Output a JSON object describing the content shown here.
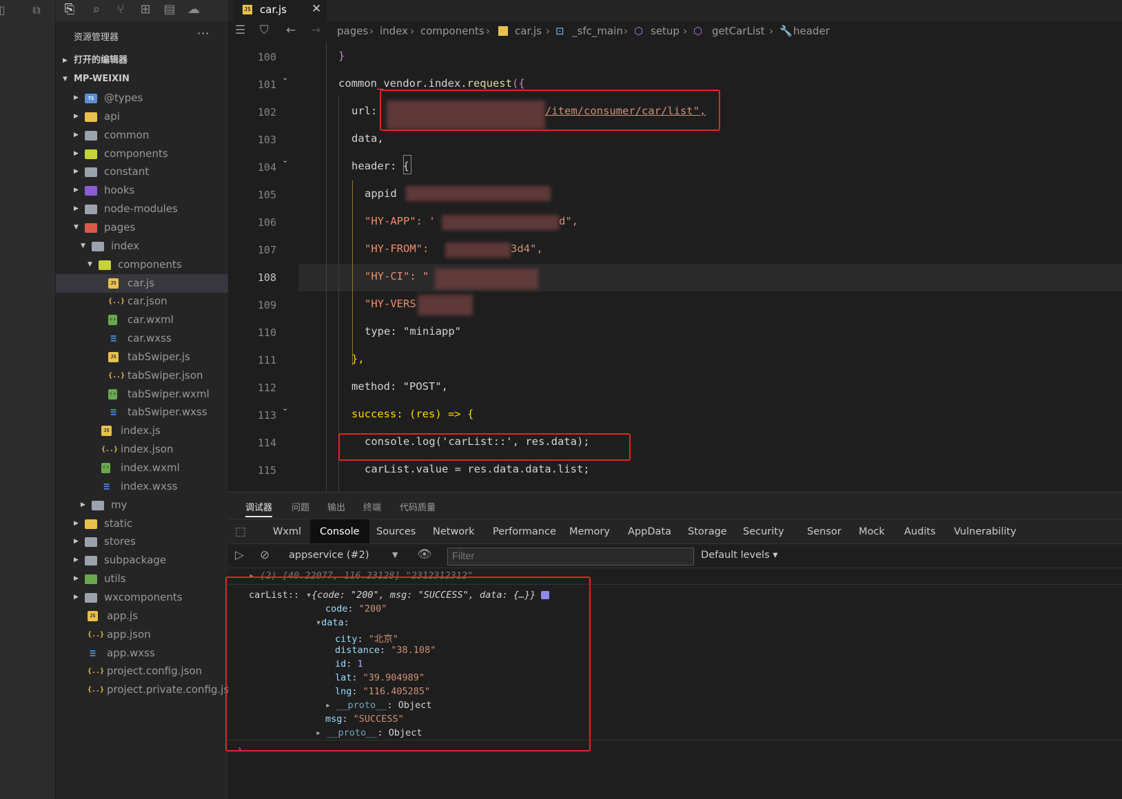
{
  "sidebar": {
    "title": "资源管理器",
    "more": "···",
    "sections": {
      "open_editors": "打开的编辑器",
      "project": "MP-WEIXIN"
    },
    "tree": [
      {
        "name": "@types",
        "type": "folder-ts"
      },
      {
        "name": "api",
        "type": "folder"
      },
      {
        "name": "common",
        "type": "folder"
      },
      {
        "name": "components",
        "type": "folder"
      },
      {
        "name": "constant",
        "type": "folder"
      },
      {
        "name": "hooks",
        "type": "folder"
      },
      {
        "name": "node-modules",
        "type": "folder"
      },
      {
        "name": "pages",
        "type": "folder"
      },
      {
        "name": "index",
        "type": "folder"
      },
      {
        "name": "components",
        "type": "folder"
      },
      {
        "name": "car.js",
        "type": "js"
      },
      {
        "name": "car.json",
        "type": "json"
      },
      {
        "name": "car.wxml",
        "type": "wxml"
      },
      {
        "name": "car.wxss",
        "type": "wxss"
      },
      {
        "name": "tabSwiper.js",
        "type": "js"
      },
      {
        "name": "tabSwiper.json",
        "type": "json"
      },
      {
        "name": "tabSwiper.wxml",
        "type": "wxml"
      },
      {
        "name": "tabSwiper.wxss",
        "type": "wxss"
      },
      {
        "name": "index.js",
        "type": "js"
      },
      {
        "name": "index.json",
        "type": "json"
      },
      {
        "name": "index.wxml",
        "type": "wxml"
      },
      {
        "name": "index.wxss",
        "type": "wxss"
      },
      {
        "name": "my",
        "type": "folder"
      },
      {
        "name": "static",
        "type": "folder"
      },
      {
        "name": "stores",
        "type": "folder"
      },
      {
        "name": "subpackage",
        "type": "folder"
      },
      {
        "name": "utils",
        "type": "folder"
      },
      {
        "name": "wxcomponents",
        "type": "folder"
      },
      {
        "name": "app.js",
        "type": "js"
      },
      {
        "name": "app.json",
        "type": "json"
      },
      {
        "name": "app.wxss",
        "type": "wxss"
      },
      {
        "name": "project.config.json",
        "type": "json"
      },
      {
        "name": "project.private.config.js...",
        "type": "json"
      }
    ]
  },
  "editor": {
    "tab": {
      "label": "car.js",
      "close": "✕"
    },
    "breadcrumbs": [
      "pages",
      "index",
      "components",
      "car.js",
      "_sfc_main",
      "setup",
      "getCarList",
      "header"
    ],
    "lines": [
      {
        "n": "100",
        "text": "}"
      },
      {
        "n": "101",
        "text": "common_vendor.index.request({"
      },
      {
        "n": "102",
        "text": "url: ",
        "str": "/item/consumer/car/list\","
      },
      {
        "n": "103",
        "text": "data,"
      },
      {
        "n": "104",
        "text": "header: {"
      },
      {
        "n": "105",
        "text": "appid"
      },
      {
        "n": "106",
        "text": "\"HY-APP\": '",
        "tail": "d\","
      },
      {
        "n": "107",
        "text": "\"HY-FROM\": ",
        "tail": "3d4\","
      },
      {
        "n": "108",
        "text": "\"HY-CI\": \""
      },
      {
        "n": "109",
        "text": "\"HY-VERS"
      },
      {
        "n": "110",
        "text": "type: \"miniapp\""
      },
      {
        "n": "111",
        "text": "},"
      },
      {
        "n": "112",
        "text": "method: \"POST\","
      },
      {
        "n": "113",
        "text": "success: (res) => {"
      },
      {
        "n": "114",
        "text": "console.log('carList::', res.data);"
      },
      {
        "n": "115",
        "text": "carList.value = res.data.data.list;"
      }
    ]
  },
  "panel": {
    "tabs": [
      "调试器",
      "问题",
      "输出",
      "终端",
      "代码质量"
    ],
    "devtools_tabs": [
      "Wxml",
      "Console",
      "Sources",
      "Network",
      "Performance",
      "Memory",
      "AppData",
      "Storage",
      "Security",
      "Sensor",
      "Mock",
      "Audits",
      "Vulnerability"
    ],
    "context": "appservice (#2)",
    "filter_placeholder": "Filter",
    "levels": "Default levels",
    "prev_line": "(2) [40.22077, 116.23128] \"2312312312\"",
    "log": {
      "label": "carList::",
      "summary": "{code: \"200\", msg: \"SUCCESS\", data: {…}}",
      "code_key": "code",
      "code_val": "\"200\"",
      "data_key": "data:",
      "city_key": "city",
      "city_val": "\"北京\"",
      "distance_key": "distance",
      "distance_val": "\"38.108\"",
      "id_key": "id",
      "id_val": "1",
      "lat_key": "lat",
      "lat_val": "\"39.904989\"",
      "lng_key": "lng",
      "lng_val": "\"116.405285\"",
      "proto_key": "__proto__",
      "proto_val": "Object",
      "msg_key": "msg",
      "msg_val": "\"SUCCESS\""
    },
    "prompt": "›"
  }
}
